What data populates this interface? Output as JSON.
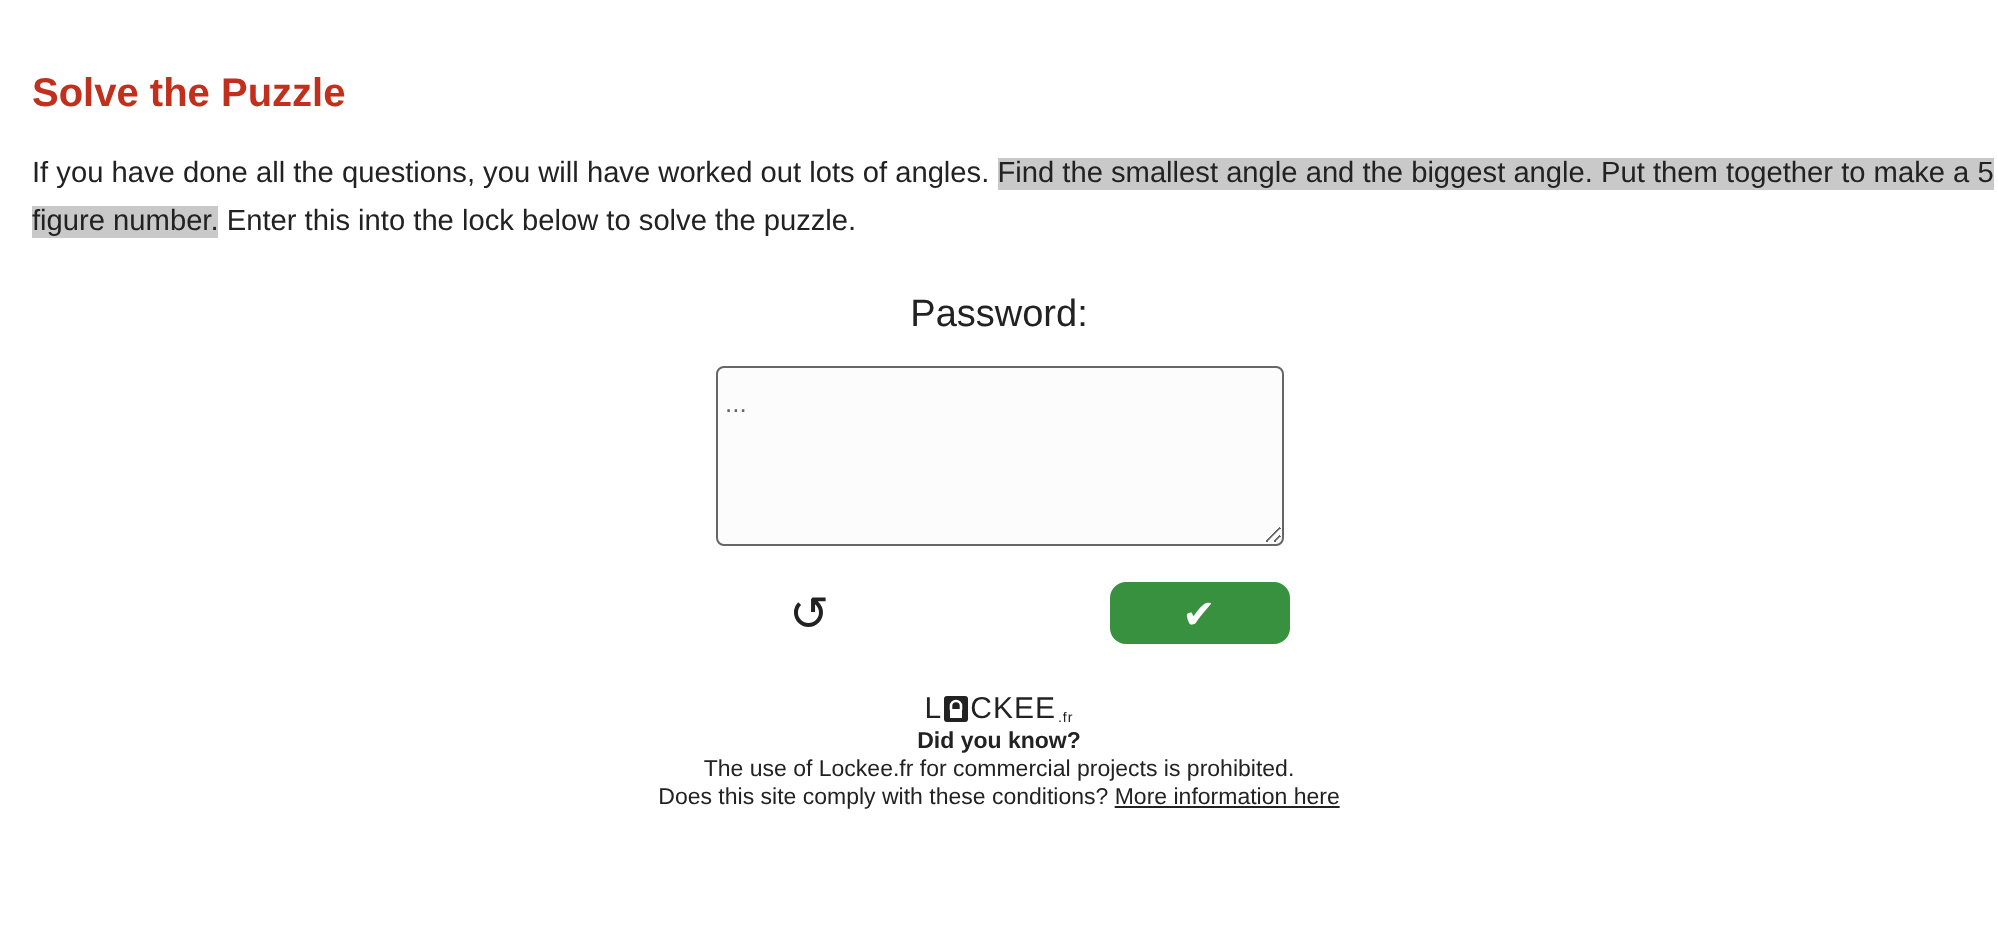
{
  "title": "Solve the Puzzle",
  "paragraph": [
    {
      "text": "If you have done all the questions, you will have worked out lots of angles. ",
      "highlighted": false
    },
    {
      "text": "Find the smallest angle and the biggest angle. Put them together to make a 5 figure number.",
      "highlighted": true
    },
    {
      "text": " Enter this into the lock below to solve the puzzle.",
      "highlighted": false
    }
  ],
  "lock": {
    "label": "Password:",
    "placeholder": "...",
    "reset": "↺",
    "submit": "✔"
  },
  "footer": {
    "logo_before": "L",
    "logo_after": "CKEE",
    "logo_suffix": ".fr",
    "heading": "Did you know?",
    "notice": "The use of Lockee.fr for commercial projects is prohibited.",
    "question": "Does this site comply with these conditions?",
    "link": "More information here"
  }
}
